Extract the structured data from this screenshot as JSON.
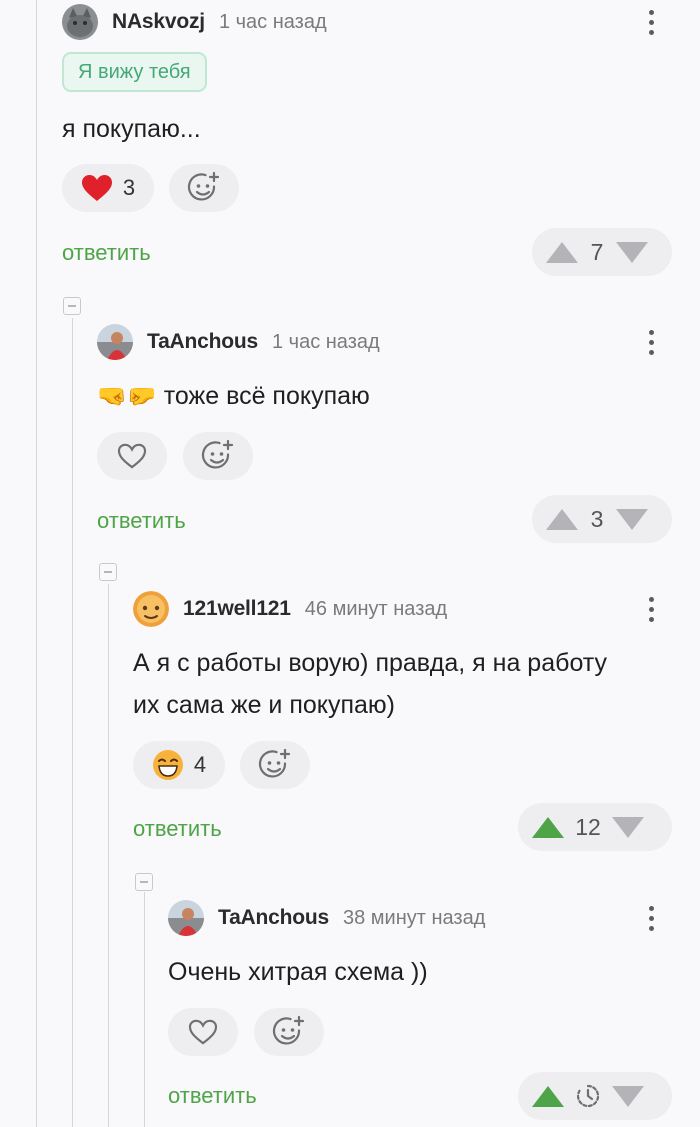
{
  "reply_label": "ответить",
  "comments": [
    {
      "username": "NAskvozj",
      "time": "1 час назад",
      "badge": "Я вижу тебя",
      "text": "я покупаю...",
      "reaction_count": "3",
      "rating": "7"
    },
    {
      "username": "TaAnchous",
      "time": "1 час назад",
      "emoji": "🤜🤛",
      "text": "тоже всё покупаю",
      "rating": "3"
    },
    {
      "username": "121well121",
      "time": "46 минут назад",
      "text_lines": [
        "А я с работы ворую) правда, я на работу",
        "их сама же и покупаю)"
      ],
      "reaction_count": "4",
      "rating": "12"
    },
    {
      "username": "TaAnchous",
      "time": "38 минут назад",
      "text": "Очень хитрая схема ))"
    }
  ],
  "colors": {
    "accent_green": "#4ea447",
    "heart_red": "#e0202a",
    "background": "#f9f9fb"
  }
}
